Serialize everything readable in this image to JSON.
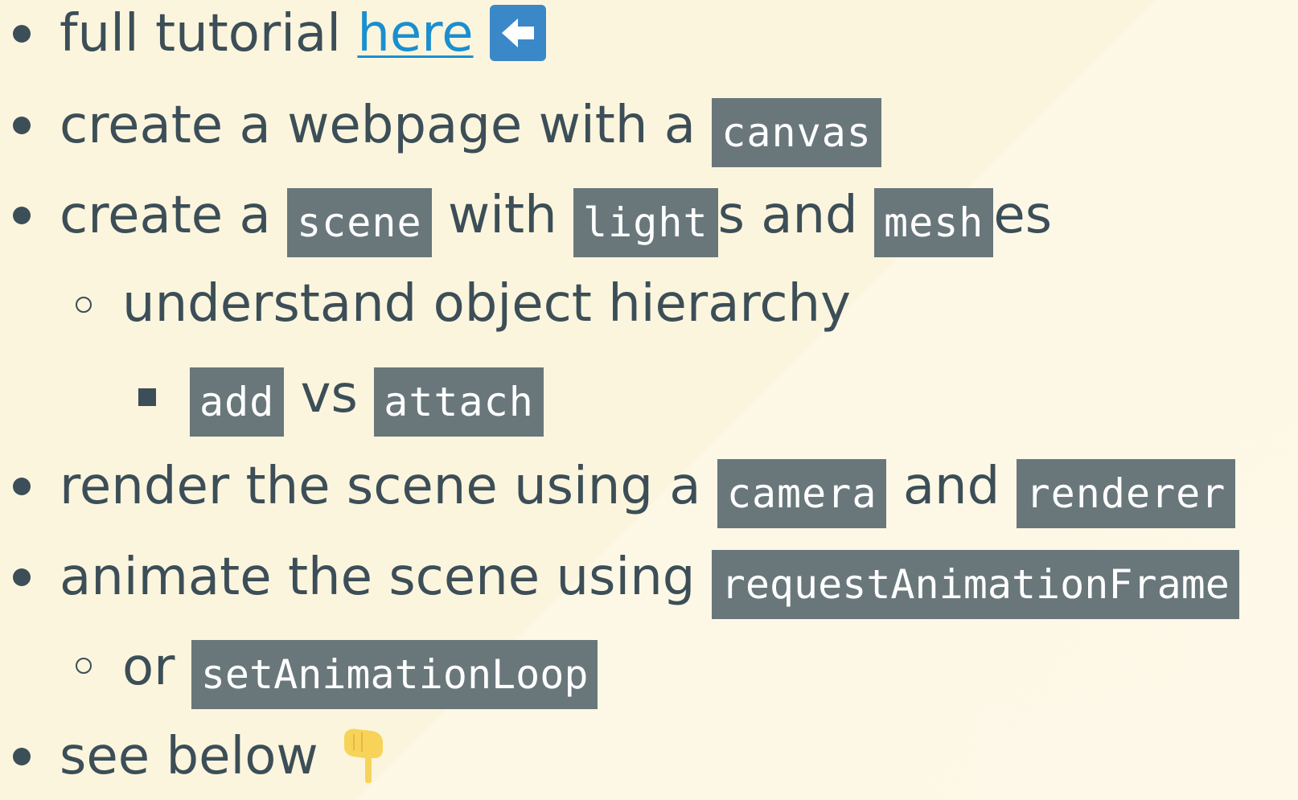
{
  "items": {
    "tutorial": {
      "prefix": "full tutorial ",
      "link_text": "here"
    },
    "webpage": {
      "text": "create a webpage with a ",
      "code": "canvas"
    },
    "scene": {
      "text1": "create a ",
      "code1": "scene",
      "text2": " with ",
      "code2": "light",
      "text3": "s and ",
      "code3": "mesh",
      "text4": "es"
    },
    "hierarchy": {
      "text": "understand object hierarchy"
    },
    "add_attach": {
      "code1": "add",
      "text": " vs ",
      "code2": "attach"
    },
    "render": {
      "text1": "render the scene using a ",
      "code1": "camera",
      "text2": " and ",
      "code2": "renderer"
    },
    "animate": {
      "text": "animate the scene using ",
      "code": "requestAnimationFrame"
    },
    "loop": {
      "text": "or ",
      "code": "setAnimationLoop"
    },
    "below": {
      "text": "see below"
    }
  },
  "icons": {
    "back": "back-arrow-icon",
    "point": "pointing-down-hand-icon"
  },
  "colors": {
    "background": "#fcf5dd",
    "text": "#3c4e57",
    "code_bg": "#69777b",
    "link": "#1a8fcf",
    "back_icon_bg": "#3b88c9",
    "hand": "#f7d35a"
  }
}
